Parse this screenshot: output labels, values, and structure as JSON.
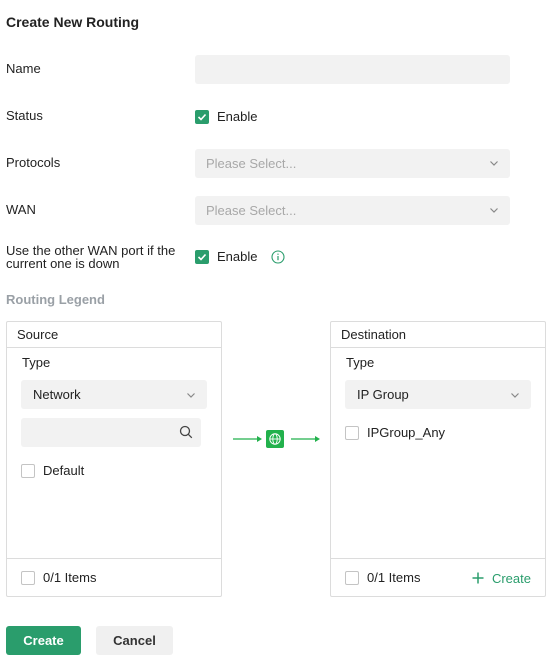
{
  "title": "Create New Routing",
  "form": {
    "name_label": "Name",
    "name_value": "",
    "status_label": "Status",
    "status_enable_label": "Enable",
    "protocols_label": "Protocols",
    "protocols_placeholder": "Please Select...",
    "wan_label": "WAN",
    "wan_placeholder": "Please Select...",
    "failover_label_line1": "Use the other WAN port if the",
    "failover_label_line2": "current one is down",
    "failover_enable_label": "Enable"
  },
  "legend_title": "Routing Legend",
  "source": {
    "header": "Source",
    "type_label": "Type",
    "type_value": "Network",
    "search_value": "",
    "items": [
      {
        "label": "Default",
        "checked": false
      }
    ],
    "footer_count": "0/1 Items"
  },
  "destination": {
    "header": "Destination",
    "type_label": "Type",
    "type_value": "IP Group",
    "items": [
      {
        "label": "IPGroup_Any",
        "checked": false
      }
    ],
    "footer_count": "0/1 Items",
    "create_label": "Create"
  },
  "buttons": {
    "create": "Create",
    "cancel": "Cancel"
  },
  "colors": {
    "accent": "#2a9d6c",
    "flow": "#22b14c"
  },
  "icons": {
    "status_checkbox": "checkbox-checked-icon",
    "info": "info-icon",
    "route": "globe-icon"
  }
}
